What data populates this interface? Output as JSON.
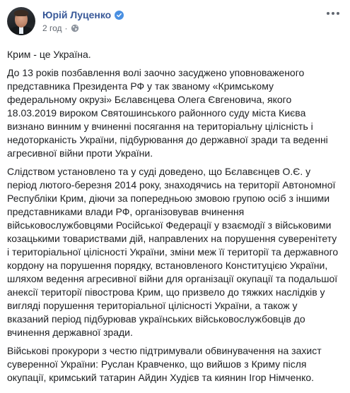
{
  "post": {
    "author": "Юрій Луценко",
    "timestamp": "2 год",
    "separator": "·",
    "paragraphs": [
      "Крим - це Україна.",
      "До 13 років позбавлення волі заочно засуджено уповноваженого представника Президента РФ у так званому «Кримському федеральному окрузі» Бєлавєнцева Олега Євгеновича, якого 18.03.2019 вироком Святошинського районного суду міста Києва визнано винним у вчиненні посягання на територіальну цілісність і недоторканість України, підбурювання до державної зради та веденні агресивної війни проти України.",
      "Слідством установлено та у суді доведено, що Бєлавєнцев О.Є. у період лютого-березня 2014 року, знаходячись на території Автономної Республіки Крим, діючи за попередньою змовою групою осіб з іншими представниками влади РФ, організовував вчинення військовослужбовцями Російської Федерації у взаємодії з військовими козацькими товариствами дій, направлених на порушення суверенітету і територіальної цілісності України, зміни меж її території та державного кордону на порушення порядку, встановленого Конституцією України, шляхом ведення агресивної війни для організації окупації та подальшої анексії території півострова Крим, що призвело до тяжких наслідків у вигляді порушення територіальної цілісності України, а також у вказаний період підбурював українських військовослужбовців до вчинення державної зради.",
      "Військові прокурори з честю підтримували обвинувачення на захист суверенної України: Руслан Кравченко, що вийшов з Криму після окупації, кримський татарин Айдин Худієв та киянин Ігор Німченко."
    ]
  },
  "colors": {
    "author_link": "#385898",
    "meta_text": "#616770",
    "body_text": "#1c1e21",
    "verified_badge": "#4a90e2"
  },
  "icons": {
    "verified": "verified-badge-icon",
    "audience": "globe-icon",
    "options": "more-options-icon"
  }
}
